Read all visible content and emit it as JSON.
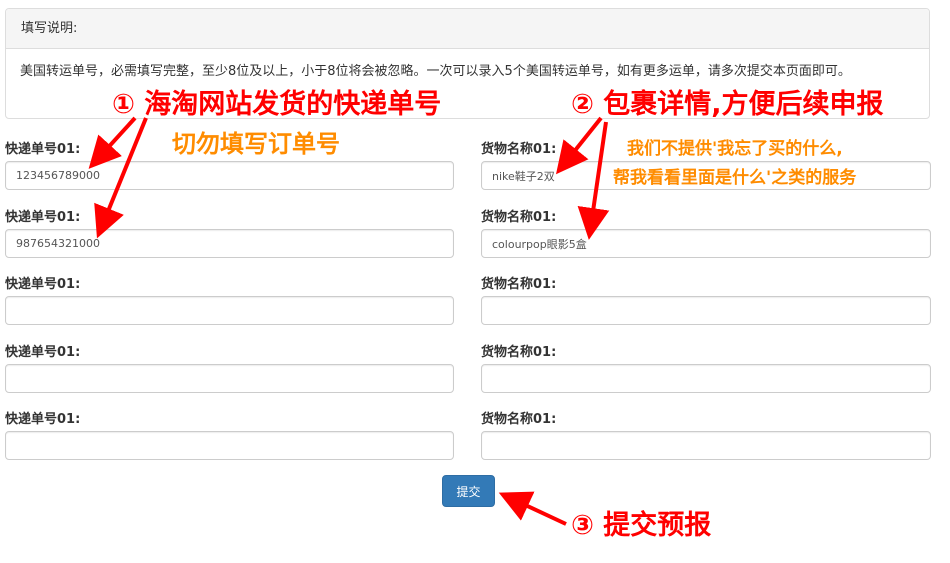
{
  "instructions": {
    "heading": "填写说明:",
    "body": "美国转运单号，必需填写完整，至少8位及以上，小于8位将会被忽略。一次可以录入5个美国转运单号，如有更多运单，请多次提交本页面即可。"
  },
  "form": {
    "rows": [
      {
        "tracking_label": "快递单号01:",
        "tracking_value": "123456789000",
        "goods_label": "货物名称01:",
        "goods_value": "nike鞋子2双"
      },
      {
        "tracking_label": "快递单号01:",
        "tracking_value": "987654321000",
        "goods_label": "货物名称01:",
        "goods_value": "colourpop眼影5盒"
      },
      {
        "tracking_label": "快递单号01:",
        "tracking_value": "",
        "goods_label": "货物名称01:",
        "goods_value": ""
      },
      {
        "tracking_label": "快递单号01:",
        "tracking_value": "",
        "goods_label": "货物名称01:",
        "goods_value": ""
      },
      {
        "tracking_label": "快递单号01:",
        "tracking_value": "",
        "goods_label": "货物名称01:",
        "goods_value": ""
      }
    ],
    "submit_label": "提交"
  },
  "annotations": {
    "a1_line1": "① 海淘网站发货的快递单号",
    "a1_line2": "切勿填写订单号",
    "a2_line1": "② 包裹详情,方便后续申报",
    "a2_line2": "我们不提供'我忘了买的什么,",
    "a2_line3": "帮我看看里面是什么'之类的服务",
    "a3": "③ 提交预报"
  },
  "colors": {
    "annotation_red": "#ff0000",
    "annotation_orange": "#ff8c00",
    "button_primary": "#337ab7"
  }
}
